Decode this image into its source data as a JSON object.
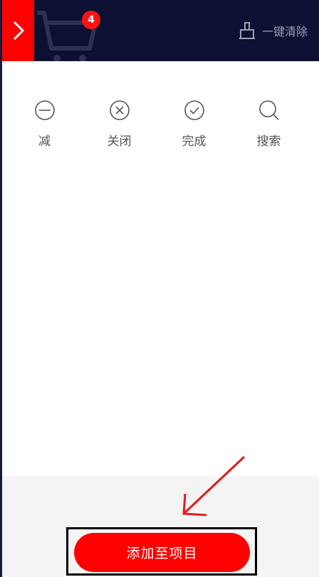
{
  "header": {
    "cart_count": "4",
    "clear_label": "一键清除"
  },
  "actions": [
    {
      "icon": "minus-circle-icon",
      "label": "减"
    },
    {
      "icon": "close-circle-icon",
      "label": "关闭"
    },
    {
      "icon": "check-circle-icon",
      "label": "完成"
    },
    {
      "icon": "search-icon",
      "label": "搜索"
    }
  ],
  "footer": {
    "add_label": "添加至项目"
  },
  "colors": {
    "header_bg": "#0d1032",
    "accent": "#ff0000",
    "annotation_arrow": "#e11b1b"
  }
}
